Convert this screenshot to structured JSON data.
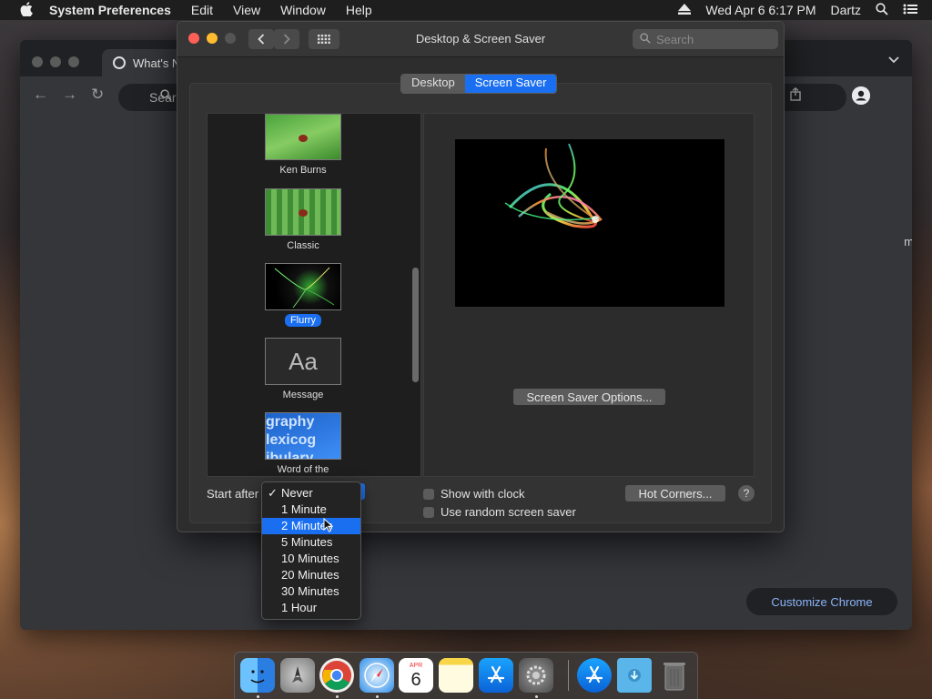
{
  "menubar": {
    "apple_icon": "apple-icon",
    "app_name": "System Preferences",
    "items": [
      "Edit",
      "View",
      "Window",
      "Help"
    ],
    "datetime": "Wed Apr 6  6:17 PM",
    "user": "Dartz"
  },
  "chrome": {
    "tab_title": "What's Ne",
    "omnibox_placeholder": "Sear",
    "side_text": "m",
    "customize_label": "Customize Chrome"
  },
  "prefs": {
    "window_title": "Desktop & Screen Saver",
    "search_placeholder": "Search",
    "tabs": [
      "Desktop",
      "Screen Saver"
    ],
    "active_tab": "Screen Saver",
    "screensavers": [
      {
        "name": "Ken Burns",
        "selected": false
      },
      {
        "name": "Classic",
        "selected": false
      },
      {
        "name": "Flurry",
        "selected": true
      },
      {
        "name": "Message",
        "selected": false,
        "thumb_text": "Aa"
      },
      {
        "name": "Word of the Day",
        "selected": false,
        "thumb_text": "graphy lexicog ibulary"
      }
    ],
    "options_button": "Screen Saver Options...",
    "start_after_label": "Start after",
    "show_clock_label": "Show with clock",
    "random_label": "Use random screen saver",
    "hot_corners_button": "Hot Corners...",
    "help_button": "?"
  },
  "dropdown": {
    "checked": "Never",
    "highlighted": "2 Minutes",
    "options": [
      "Never",
      "1 Minute",
      "2 Minutes",
      "5 Minutes",
      "10 Minutes",
      "20 Minutes",
      "30 Minutes",
      "1 Hour"
    ]
  },
  "dock": {
    "apps": [
      "finder-icon",
      "launchpad-icon",
      "chrome-icon",
      "safari-icon",
      "calendar-icon",
      "notes-icon",
      "app-store-icon",
      "system-preferences-icon",
      "app-store-folder-icon",
      "downloads-folder-icon",
      "trash-icon"
    ],
    "calendar_month": "APR",
    "calendar_day": "6"
  },
  "colors": {
    "accent": "#1a6ff0",
    "close": "#fe5f57",
    "minimize": "#febc2e"
  }
}
